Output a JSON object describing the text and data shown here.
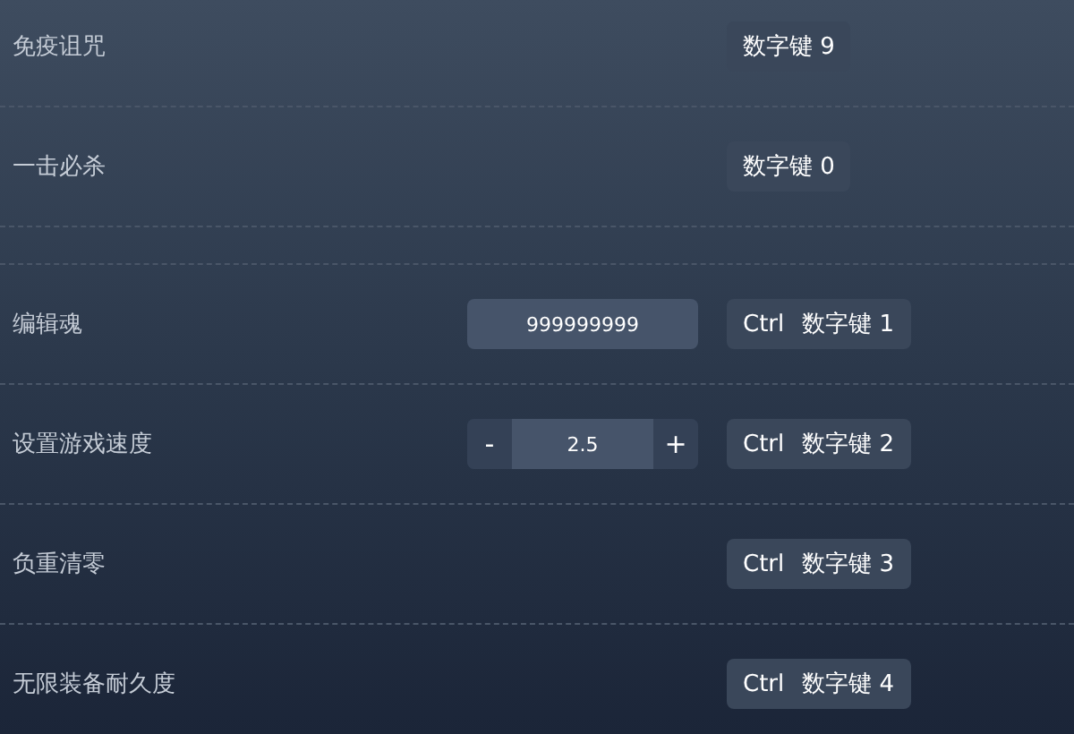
{
  "sections": [
    {
      "rows": [
        {
          "label": "免疫诅咒",
          "control": {
            "kind": "none"
          },
          "hotkey": {
            "keys": [
              "数字键 9"
            ]
          }
        },
        {
          "label": "一击必杀",
          "control": {
            "kind": "none"
          },
          "hotkey": {
            "keys": [
              "数字键 0"
            ]
          }
        }
      ]
    },
    {
      "rows": [
        {
          "label": "编辑魂",
          "control": {
            "kind": "text",
            "value": "999999999"
          },
          "hotkey": {
            "keys": [
              "Ctrl",
              "数字键 1"
            ]
          }
        },
        {
          "label": "设置游戏速度",
          "control": {
            "kind": "stepper",
            "value": "2.5",
            "minus": "-",
            "plus": "+"
          },
          "hotkey": {
            "keys": [
              "Ctrl",
              "数字键 2"
            ]
          }
        },
        {
          "label": "负重清零",
          "control": {
            "kind": "none"
          },
          "hotkey": {
            "keys": [
              "Ctrl",
              "数字键 3"
            ]
          }
        },
        {
          "label": "无限装备耐久度",
          "control": {
            "kind": "none"
          },
          "hotkey": {
            "keys": [
              "Ctrl",
              "数字键 4"
            ]
          }
        }
      ]
    }
  ]
}
